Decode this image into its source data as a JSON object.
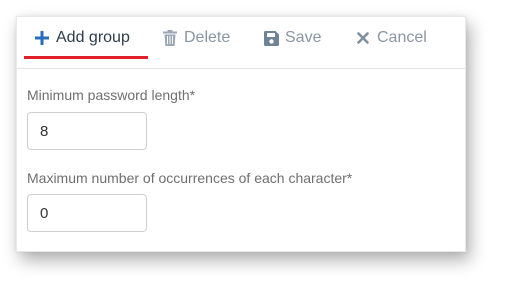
{
  "toolbar": {
    "add_group_label": "Add group",
    "delete_label": "Delete",
    "save_label": "Save",
    "cancel_label": "Cancel",
    "active_tab": "Add group",
    "accent_color": "#e0202a"
  },
  "form": {
    "min_length": {
      "label": "Minimum password length*",
      "value": "8"
    },
    "max_occurrences": {
      "label": "Maximum number of occurrences of each character*",
      "value": "0"
    }
  },
  "icons": {
    "add": "plus-icon",
    "delete": "trash-icon",
    "save": "floppy-disk-icon",
    "cancel": "close-icon"
  }
}
